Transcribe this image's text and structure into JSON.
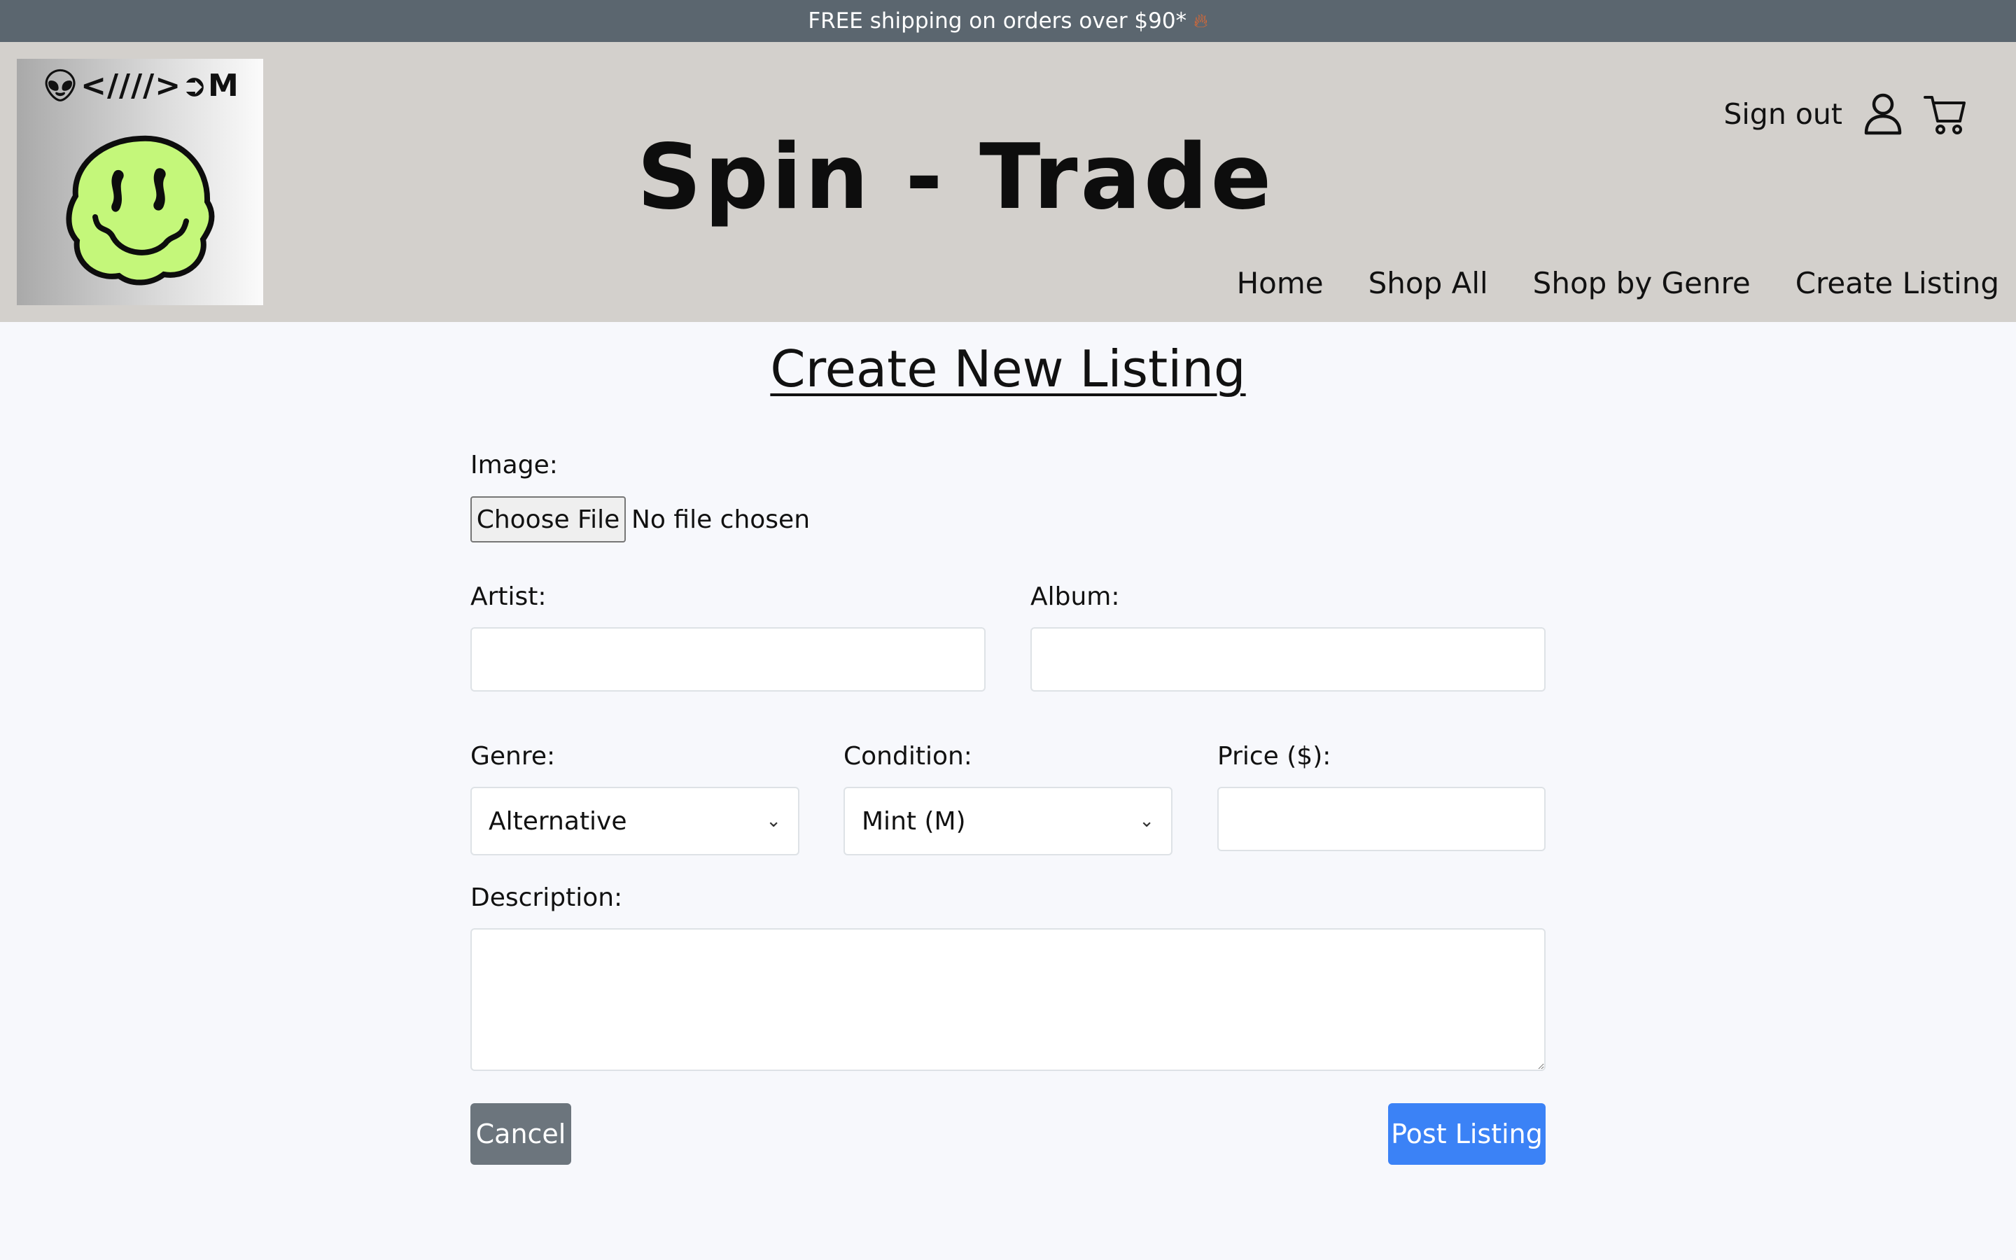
{
  "promo": {
    "text": "FREE shipping on orders over $90*",
    "icon": "fire-icon"
  },
  "header": {
    "logo_text": "👽︎<////>➲M",
    "logo_icon": "melting-smiley-icon",
    "brand": "Spin - Trade",
    "sign_out": "Sign out",
    "user_icon": "user-icon",
    "cart_icon": "cart-icon",
    "nav": [
      "Home",
      "Shop All",
      "Shop by Genre",
      "Create Listing"
    ]
  },
  "form": {
    "title": "Create New Listing",
    "image_label": "Image:",
    "choose_file": "Choose File",
    "file_status": "No file chosen",
    "artist_label": "Artist:",
    "artist_value": "",
    "album_label": "Album:",
    "album_value": "",
    "genre_label": "Genre:",
    "genre_selected": "Alternative",
    "condition_label": "Condition:",
    "condition_selected": "Mint (M)",
    "price_label": "Price ($):",
    "price_value": "",
    "description_label": "Description:",
    "description_value": "",
    "cancel": "Cancel",
    "post": "Post Listing"
  },
  "colors": {
    "promo_bg": "#5b666f",
    "header_bg": "#d3d0cc",
    "page_bg": "#f7f8fc",
    "cancel_bg": "#6c757d",
    "post_bg": "#3b82f6",
    "smiley": "#c4f77a"
  }
}
